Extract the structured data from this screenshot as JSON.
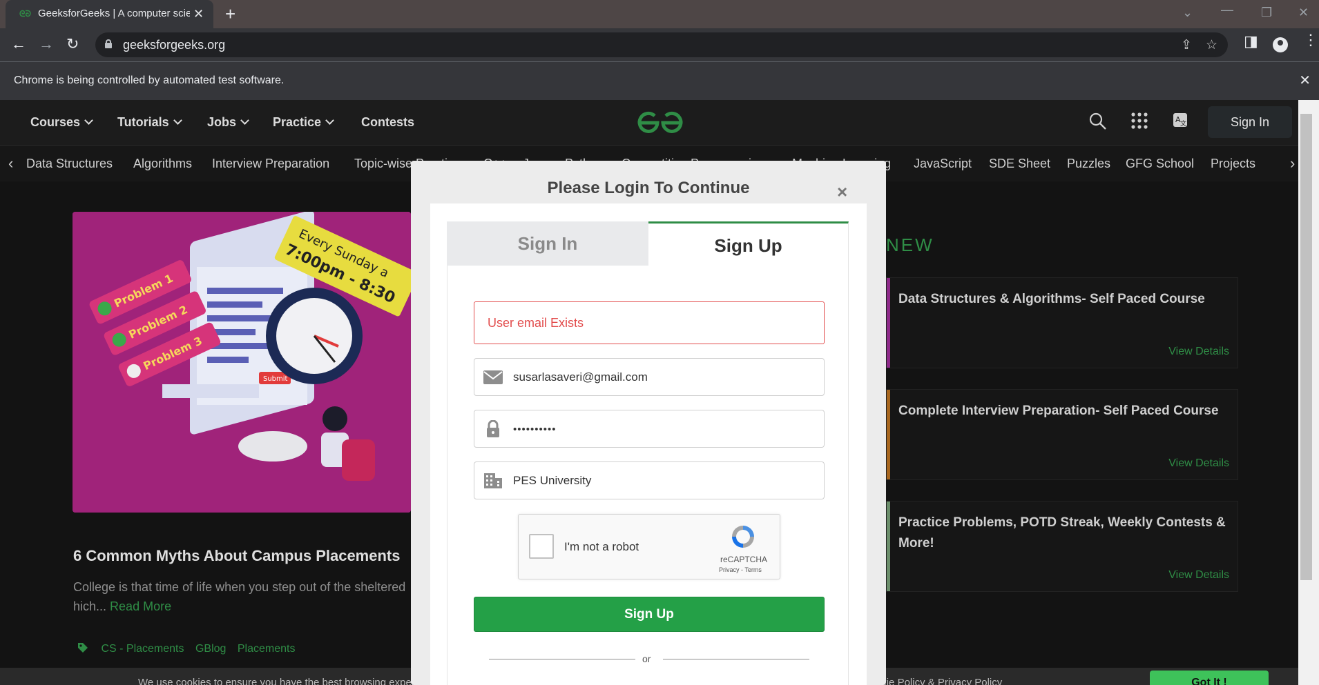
{
  "browser": {
    "tab_title": "GeeksforGeeks | A computer scie",
    "tab_favicon": "gfg-icon",
    "url": "geeksforgeeks.org",
    "infobar_text": "Chrome is being controlled by automated test software."
  },
  "header": {
    "nav": [
      {
        "label": "Courses"
      },
      {
        "label": "Tutorials"
      },
      {
        "label": "Jobs"
      },
      {
        "label": "Practice"
      },
      {
        "label": "Contests"
      }
    ],
    "signin_label": "Sign In"
  },
  "subnav": {
    "items": [
      "Data Structures",
      "Algorithms",
      "Interview Preparation",
      "Topic-wise Practice",
      "C++",
      "Java",
      "Python",
      "Competitive Programming",
      "Machine Learning",
      "JavaScript",
      "SDE Sheet",
      "Puzzles",
      "GFG School",
      "Projects"
    ]
  },
  "article": {
    "image_text": {
      "badge": "Every Sunday a",
      "time": "7:00pm - 8:30",
      "problems": [
        "Problem 1",
        "Problem 2",
        "Problem 3"
      ],
      "submit": "Submit"
    },
    "title": "6 Common Myths About Campus Placements",
    "excerpt": "College is that time of life when you step out of the sheltered",
    "excerpt_line2": "hich...",
    "read_more": "Read More",
    "tags": [
      "CS - Placements",
      "GBlog",
      "Placements"
    ]
  },
  "new_section": {
    "title": "NEW",
    "courses": [
      {
        "name": "Data Structures & Algorithms- Self Paced Course",
        "link": "View Details",
        "accent": "#8e2a8a"
      },
      {
        "name": "Complete Interview Preparation- Self Paced Course",
        "link": "View Details",
        "accent": "#a8661e"
      },
      {
        "name": "Practice Problems, POTD Streak, Weekly Contests & More!",
        "link": "View Details",
        "accent": "#6b8e6b"
      }
    ]
  },
  "modal": {
    "title": "Please Login To Continue",
    "close": "×",
    "tabs": {
      "signin": "Sign In",
      "signup": "Sign Up"
    },
    "error": "User email Exists",
    "email_value": "susarlasaveri@gmail.com",
    "password_value": "••••••••••",
    "institution_value": "PES University",
    "recaptcha": {
      "label": "I'm not a robot",
      "brand": "reCAPTCHA",
      "links": "Privacy - Terms"
    },
    "submit_label": "Sign Up",
    "or_text": "or"
  },
  "cookie": {
    "text": "We use cookies to ensure you have the best browsing experience on our website. By using our site, you acknowledge that you have read and understood our Cookie Policy & Privacy Policy",
    "button": "Got It !"
  },
  "colors": {
    "brand_green": "#2f8d46",
    "error_red": "#e24b4b",
    "button_green": "#24a047"
  }
}
